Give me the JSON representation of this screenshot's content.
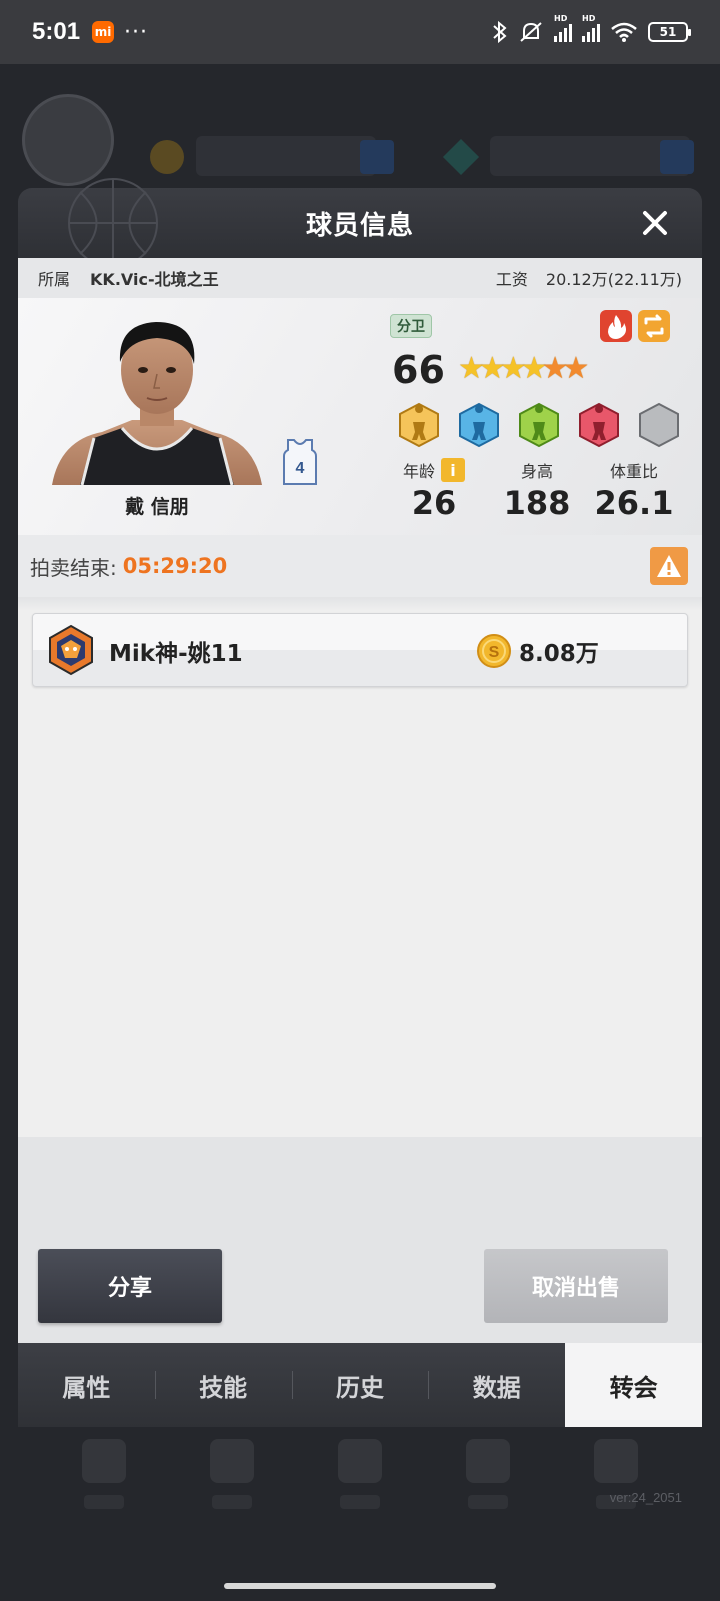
{
  "status_bar": {
    "time": "5:01",
    "app_badge": "mi",
    "more": "···",
    "battery": "51",
    "hd_label": "HD"
  },
  "modal": {
    "title": "球员信息",
    "close_icon": "close-icon"
  },
  "info": {
    "team_label": "所属",
    "team_value": "KK.Vic-北境之王",
    "salary_label": "工资",
    "salary_value": "20.12万(22.11万)"
  },
  "player": {
    "name": "戴 信朋",
    "jersey_number": "4",
    "position": "分卫",
    "rating": "66",
    "stars": {
      "total": 6,
      "gold": 4,
      "orange": 2
    },
    "skills": [
      "gold-skill-icon",
      "blue-skill-icon",
      "green-skill-icon",
      "red-skill-icon",
      "grey-skill-icon"
    ],
    "stats": {
      "age_label": "年龄",
      "age_info": "i",
      "age": "26",
      "height_label": "身高",
      "height": "188",
      "weight_ratio_label": "体重比",
      "weight_ratio": "26.1"
    }
  },
  "auction": {
    "label": "拍卖结束:",
    "timer": "05:29:20"
  },
  "bids": [
    {
      "bidder": "Mik神-姚11",
      "amount": "8.08万"
    }
  ],
  "actions": {
    "share": "分享",
    "cancel_sale": "取消出售"
  },
  "tabs": [
    {
      "label": "属性",
      "active": false
    },
    {
      "label": "技能",
      "active": false
    },
    {
      "label": "历史",
      "active": false
    },
    {
      "label": "数据",
      "active": false
    },
    {
      "label": "转会",
      "active": true
    }
  ],
  "version": "ver:24_2051",
  "colors": {
    "accent_orange": "#ee7420",
    "header_dark": "#34363c",
    "tab_active_bg": "#f4f4f5"
  }
}
